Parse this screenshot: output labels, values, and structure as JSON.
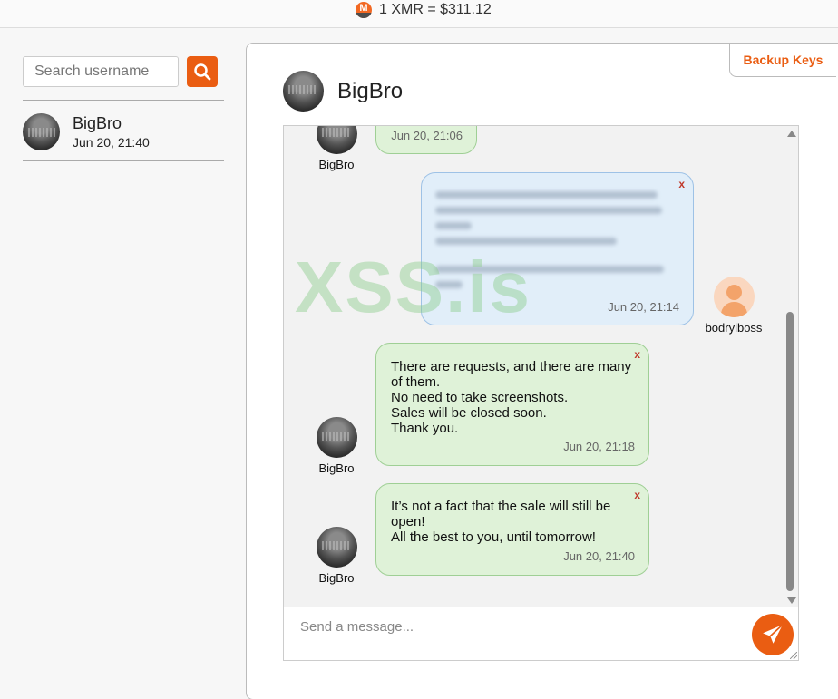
{
  "header": {
    "rate": "1 XMR = $311.12"
  },
  "sidebar": {
    "search": {
      "placeholder": "Search username"
    },
    "contacts": [
      {
        "name": "BigBro",
        "time": "Jun 20, 21:40"
      }
    ]
  },
  "chat": {
    "backup_label": "Backup Keys",
    "title": "BigBro",
    "watermark": "XSS.is",
    "messages": [
      {
        "sender": "BigBro",
        "time": "Jun 20, 21:06",
        "text": ""
      },
      {
        "sender": "bodryiboss",
        "time": "Jun 20, 21:14",
        "text": "",
        "close": "x"
      },
      {
        "sender": "BigBro",
        "time": "Jun 20, 21:18",
        "close": "x",
        "lines": [
          "There are requests, and there are many",
          "of them.",
          "No need to take screenshots.",
          "Sales will be closed soon.",
          "Thank you."
        ]
      },
      {
        "sender": "BigBro",
        "time": "Jun 20, 21:40",
        "close": "x",
        "lines": [
          "It’s not a fact that the sale will still be",
          "open!",
          "All the best to you, until tomorrow!"
        ]
      }
    ],
    "composer": {
      "placeholder": "Send a message..."
    }
  },
  "icons": {
    "currency": "monero-icon",
    "search": "search-icon",
    "send": "paper-plane-icon",
    "user": "user-silhouette-icon"
  },
  "colors": {
    "accent": "#ea5d12",
    "incoming_bubble": "#dff2d8",
    "outgoing_bubble": "#e1eef9"
  }
}
